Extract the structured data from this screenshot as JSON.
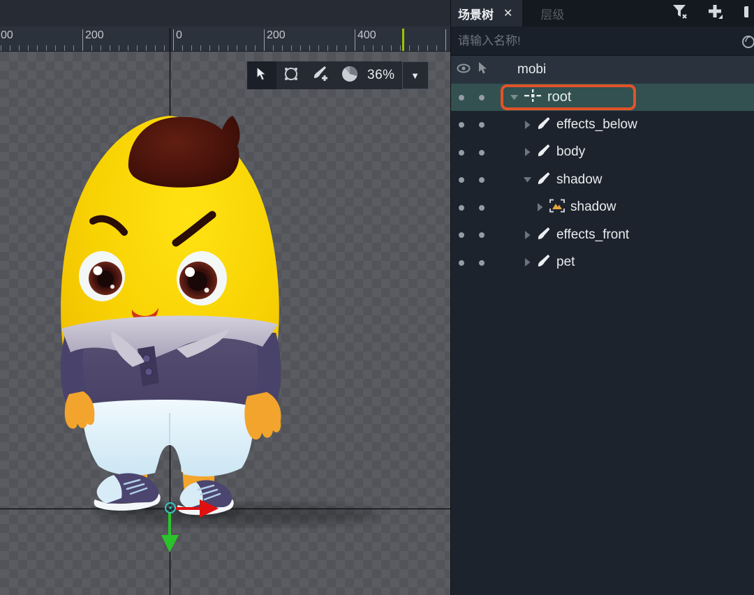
{
  "canvas": {
    "toolbar": {
      "tools": [
        "select-cursor",
        "transform-circle",
        "add-bone",
        "weights-pie"
      ],
      "active_tool": "select-cursor",
      "zoom_level": "36%"
    },
    "ruler": {
      "labels": [
        {
          "text": "00"
        },
        {
          "text": "200"
        },
        {
          "text": "0"
        },
        {
          "text": "200"
        },
        {
          "text": "400"
        }
      ],
      "green_marker_color": "#9CC400"
    },
    "gizmo": {
      "x_axis_color": "#E01010",
      "y_axis_color": "#2BC32B",
      "origin_color": "#36C8C2"
    },
    "character": {
      "description": "yellow egg mascot with dark red hair swirl, angry brows, purple polo shirt, light blue shorts, purple sneakers",
      "body_color": "#F8D203",
      "hair_color": "#48130B",
      "shirt_color": "#4E4769",
      "collar_color": "#C6C2D0",
      "shorts_color": "#E8F5FC",
      "skin_color": "#F2A42C",
      "shoe_color": "#4C4570",
      "shoe_toe_color": "#D8ECF8",
      "mouth_color": "#D23418"
    }
  },
  "panel": {
    "tabs": [
      {
        "label": "场景树",
        "close_label": "✕",
        "active": true
      },
      {
        "label": "层级",
        "active": false
      }
    ],
    "header_icons": [
      "filter-icon",
      "add-icon"
    ],
    "search": {
      "placeholder": "请输入名称!"
    },
    "tree": {
      "selection_highlight_color": "#E25329",
      "selected_row_color": "#325150",
      "rows": [
        {
          "label": "mobi",
          "type": "header",
          "icons": [
            "eye",
            "cursor"
          ]
        },
        {
          "label": "root",
          "type": "bone-root",
          "expanded": true,
          "selected": true,
          "highlighted": true
        },
        {
          "label": "effects_below",
          "type": "bone",
          "expanded": false
        },
        {
          "label": "body",
          "type": "bone",
          "expanded": false
        },
        {
          "label": "shadow",
          "type": "bone",
          "expanded": true
        },
        {
          "label": "shadow",
          "type": "image",
          "expanded": false,
          "depth": 3
        },
        {
          "label": "effects_front",
          "type": "bone",
          "expanded": false
        },
        {
          "label": "pet",
          "type": "bone",
          "expanded": false
        }
      ]
    }
  }
}
